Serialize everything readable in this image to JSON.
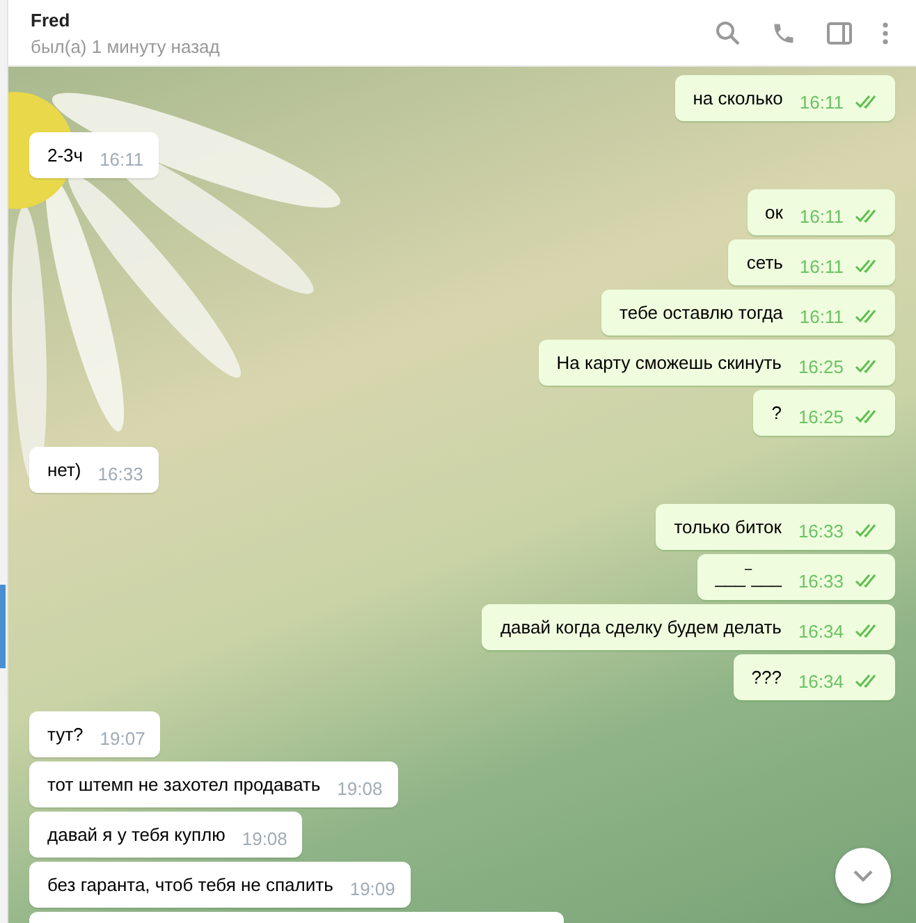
{
  "header": {
    "name": "Fred",
    "status": "был(а) 1 минуту назад"
  },
  "messages": [
    {
      "kind": "out",
      "text": "на сколько",
      "time": "16:11",
      "read": true
    },
    {
      "kind": "in",
      "text": "2-3ч",
      "time": "16:11"
    },
    {
      "kind": "out",
      "text": "ок",
      "time": "16:11",
      "read": true
    },
    {
      "kind": "out",
      "text": "сеть",
      "time": "16:11",
      "read": true
    },
    {
      "kind": "out",
      "text": "тебе оставлю тогда",
      "time": "16:11",
      "read": true
    },
    {
      "kind": "out",
      "text": "На карту сможешь скинуть",
      "time": "16:25",
      "read": true
    },
    {
      "kind": "out",
      "text": "?",
      "time": "16:25",
      "read": true
    },
    {
      "kind": "in",
      "text": "нет)",
      "time": "16:33"
    },
    {
      "kind": "out",
      "text": "только биток",
      "time": "16:33",
      "read": true
    },
    {
      "kind": "out",
      "text": "___‾___",
      "time": "16:33",
      "read": true
    },
    {
      "kind": "out",
      "text": "давай когда сделку будем делать",
      "time": "16:34",
      "read": true
    },
    {
      "kind": "out",
      "text": "???",
      "time": "16:34",
      "read": true
    },
    {
      "kind": "in",
      "text": "тут?",
      "time": "19:07"
    },
    {
      "kind": "in",
      "text": "тот штемп не захотел продавать",
      "time": "19:08"
    },
    {
      "kind": "in",
      "text": "давай я у тебя куплю",
      "time": "19:08"
    },
    {
      "kind": "in",
      "text": "без гаранта, чтоб тебя не спалить",
      "time": "19:09"
    }
  ]
}
